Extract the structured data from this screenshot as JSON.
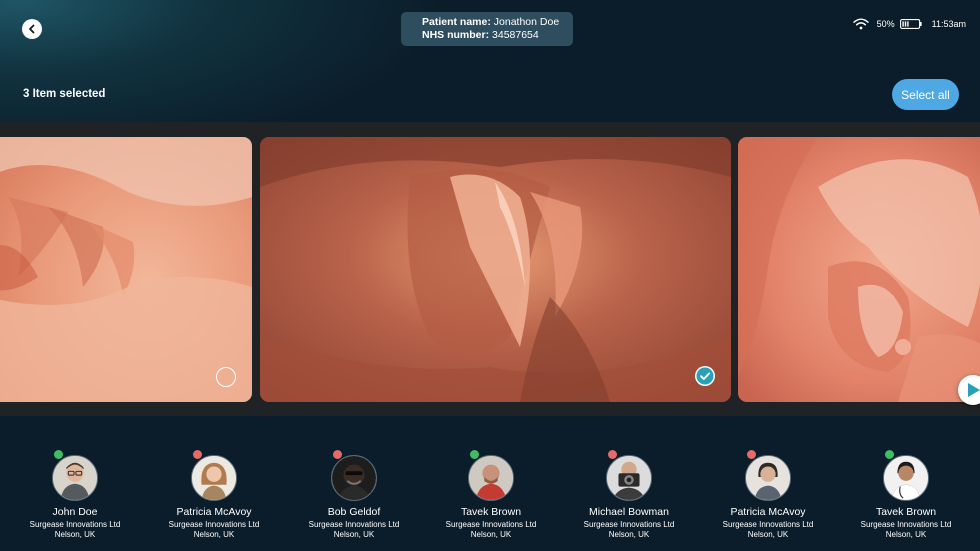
{
  "header": {
    "patient_name_label": "Patient name:",
    "patient_name": "Jonathon Doe",
    "nhs_label": "NHS number:",
    "nhs_number": "34587654"
  },
  "status_bar": {
    "battery_percent": "50%",
    "time": "11:53am",
    "icons": [
      "wifi-icon",
      "battery-icon"
    ]
  },
  "toolbar": {
    "selected_count": "3 Item selected",
    "select_all_label": "Select all",
    "select_all_color": "#4ea8e4"
  },
  "gallery": {
    "images": [
      {
        "id": "left",
        "selected": false
      },
      {
        "id": "center",
        "selected": true
      },
      {
        "id": "right",
        "selected": false
      }
    ],
    "check_color": "#28a0b8"
  },
  "people": [
    {
      "name": "John Doe",
      "org": "Surgease Innovations Ltd",
      "location": "Nelson, UK",
      "status": "online"
    },
    {
      "name": "Patricia McAvoy",
      "org": "Surgease Innovations Ltd",
      "location": "Nelson, UK",
      "status": "offline"
    },
    {
      "name": "Bob Geldof",
      "org": "Surgease Innovations Ltd",
      "location": "Nelson, UK",
      "status": "offline"
    },
    {
      "name": "Tavek Brown",
      "org": "Surgease Innovations Ltd",
      "location": "Nelson, UK",
      "status": "online"
    },
    {
      "name": "Michael Bowman",
      "org": "Surgease Innovations Ltd",
      "location": "Nelson, UK",
      "status": "offline"
    },
    {
      "name": "Patricia McAvoy",
      "org": "Surgease Innovations Ltd",
      "location": "Nelson, UK",
      "status": "offline"
    },
    {
      "name": "Tavek Brown",
      "org": "Surgease Innovations Ltd",
      "location": "Nelson, UK",
      "status": "online"
    }
  ],
  "status_colors": {
    "online": "#3fbd63",
    "offline": "#e56a6a"
  }
}
